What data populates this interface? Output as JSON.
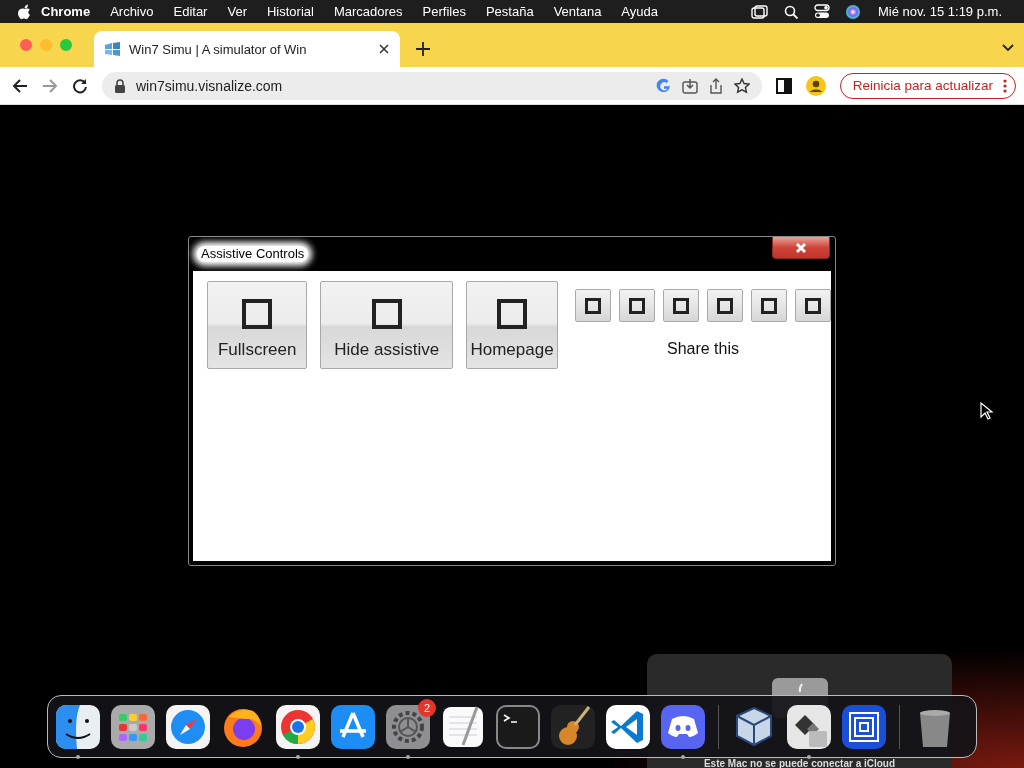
{
  "menubar": {
    "app": "Chrome",
    "menus": [
      "Archivo",
      "Editar",
      "Ver",
      "Historial",
      "Marcadores",
      "Perfiles",
      "Pestaña",
      "Ventana",
      "Ayuda"
    ],
    "clock": "Mié nov. 15 1:19 p.m."
  },
  "browser": {
    "tabs": [
      {
        "title": "Win7 Simu | A simulator of Win",
        "selected": true
      }
    ],
    "address": "win7simu.visnalize.com",
    "update_button": "Reinicia para actualizar"
  },
  "dialog": {
    "title": "Assistive Controls",
    "buttons": [
      {
        "label": "Fullscreen"
      },
      {
        "label": "Hide assistive"
      },
      {
        "label": "Homepage"
      }
    ],
    "share_buttons": [
      {
        "kind": "share"
      },
      {
        "kind": "share"
      },
      {
        "kind": "share"
      },
      {
        "kind": "share"
      },
      {
        "kind": "share"
      },
      {
        "kind": "share"
      }
    ],
    "share_label": "Share this"
  },
  "notification": {
    "text": "Este Mac no se puede conectar a iCloud"
  },
  "dock": {
    "items": [
      {
        "kind": "finder",
        "running": true
      },
      {
        "kind": "launchpad",
        "running": false
      },
      {
        "kind": "safari",
        "running": false
      },
      {
        "kind": "firefox",
        "running": false
      },
      {
        "kind": "chrome",
        "running": true
      },
      {
        "kind": "appstore",
        "running": false
      },
      {
        "kind": "settings",
        "running": true,
        "badge": "2"
      },
      {
        "kind": "textedit",
        "running": false
      },
      {
        "kind": "terminal",
        "running": false
      },
      {
        "kind": "garageband",
        "running": false
      },
      {
        "kind": "vscode",
        "running": false
      },
      {
        "kind": "discord",
        "running": true
      },
      {
        "kind": "separator"
      },
      {
        "kind": "virtualbox",
        "running": false
      },
      {
        "kind": "bootcamp",
        "running": true
      },
      {
        "kind": "bluesquare",
        "running": false
      },
      {
        "kind": "separator"
      },
      {
        "kind": "trash",
        "running": false
      }
    ]
  }
}
